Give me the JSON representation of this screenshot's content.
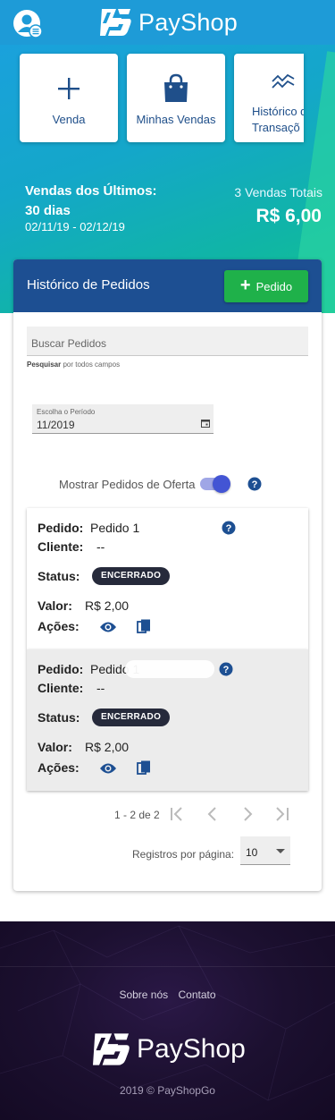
{
  "header": {
    "brand": "PayShop",
    "avatar_icon": "user-settings-icon"
  },
  "quick_actions": [
    {
      "label": "Venda",
      "icon": "plus-icon"
    },
    {
      "label": "Minhas Vendas",
      "icon": "shopping-bag-icon"
    },
    {
      "label": "Histórico de Transações",
      "icon": "chart-line-icon",
      "visible_line1": "Histórico d",
      "visible_line2": "Transaçõ"
    }
  ],
  "sales_summary": {
    "title": "Vendas dos Últimos: 30 dias",
    "dates": "02/11/19 - 02/12/19",
    "count": "3 Vendas Totais",
    "total": "R$ 6,00"
  },
  "orders_card": {
    "title": "Histórico de Pedidos",
    "new_button": "Pedido",
    "search_placeholder": "Buscar Pedidos",
    "search_hint_bold": "Pesquisar",
    "search_hint_rest": " por todos campos",
    "period_label": "Escolha o Período",
    "period_value": "11/2019",
    "offer_toggle_label": "Mostrar Pedidos de Oferta",
    "offer_toggle_on": true
  },
  "order_labels": {
    "pedido": "Pedido:",
    "cliente": "Cliente:",
    "status": "Status:",
    "valor": "Valor:",
    "acoes": "Ações:"
  },
  "orders": [
    {
      "pedido": "Pedido 1",
      "cliente": "--",
      "status": "ENCERRADO",
      "valor": "R$ 2,00"
    },
    {
      "pedido": "Pedido 1",
      "cliente": "--",
      "status": "ENCERRADO",
      "valor": "R$ 2,00"
    }
  ],
  "pagination": {
    "range": "1 - 2 de 2",
    "per_page_label": "Registros por página:",
    "per_page_value": "10"
  },
  "footer": {
    "about": "Sobre nós",
    "contact": "Contato",
    "brand": "PayShop",
    "copyright": "2019 © PayShopGo"
  },
  "colors": {
    "header_blue": "#1e9bd7",
    "card_header_navy": "#1d4f92",
    "action_green": "#1fb14a",
    "badge_dark": "#262a3b",
    "icon_blue": "#1d4f92",
    "footer_purple": "#1c1030"
  }
}
